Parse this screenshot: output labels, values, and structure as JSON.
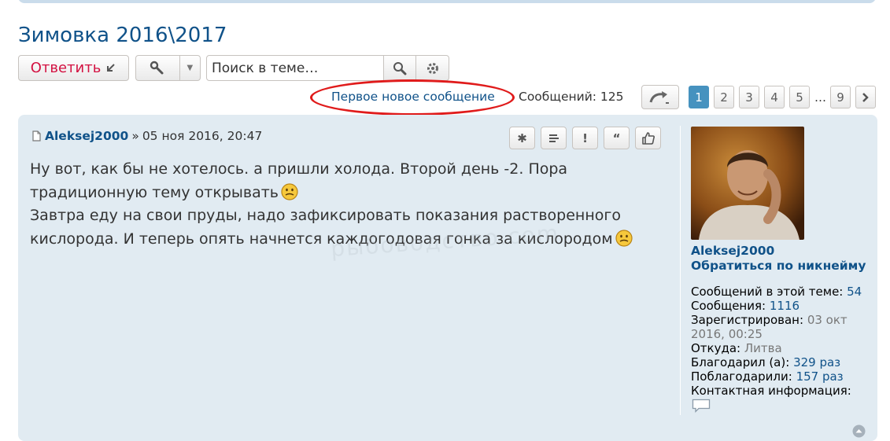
{
  "topic": {
    "title": "Зимовка 2016\\2017"
  },
  "actions": {
    "reply_label": "Ответить",
    "search_placeholder": "Поиск в теме…"
  },
  "pagination": {
    "first_new_label": "Первое новое сообщение",
    "messages_count": "Сообщений: 125",
    "pages": [
      "1",
      "2",
      "3",
      "4",
      "5",
      "9"
    ],
    "current_page": "1",
    "ellipsis": "…"
  },
  "post": {
    "author": "Aleksej2000",
    "separator": "»",
    "date": "05 ноя 2016, 20:47",
    "lines": [
      "Ну вот, как бы не хотелось. а пришли холода. Второй день -2. Пора",
      "традиционную тему открывать",
      "Завтра еду на свои пруды, надо зафиксировать показания растворенного",
      "кислорода. И теперь опять начнется каждогодовая гонка за кислородом"
    ],
    "watermark": "рыбоводство.com"
  },
  "profile": {
    "name": "Aleksej2000",
    "pm_label": "Обратиться по никнейму",
    "stats": [
      {
        "label": "Сообщений в этой теме:",
        "value": "54"
      },
      {
        "label": "Сообщения:",
        "value": "1116"
      },
      {
        "label": "Зарегистрирован:",
        "value": "03 окт 2016, 00:25"
      },
      {
        "label": "Откуда:",
        "value": "Литва"
      },
      {
        "label": "Благодарил (а):",
        "value": "329 раз"
      },
      {
        "label": "Поблагодарили:",
        "value": "157 раз"
      },
      {
        "label": "Контактная информация:",
        "value": ""
      }
    ]
  },
  "colors": {
    "link": "#105289",
    "reply": "#d31141",
    "post_bg": "#e1ebf2",
    "active_page": "#4692bf",
    "highlight_oval": "#e01b1b"
  }
}
